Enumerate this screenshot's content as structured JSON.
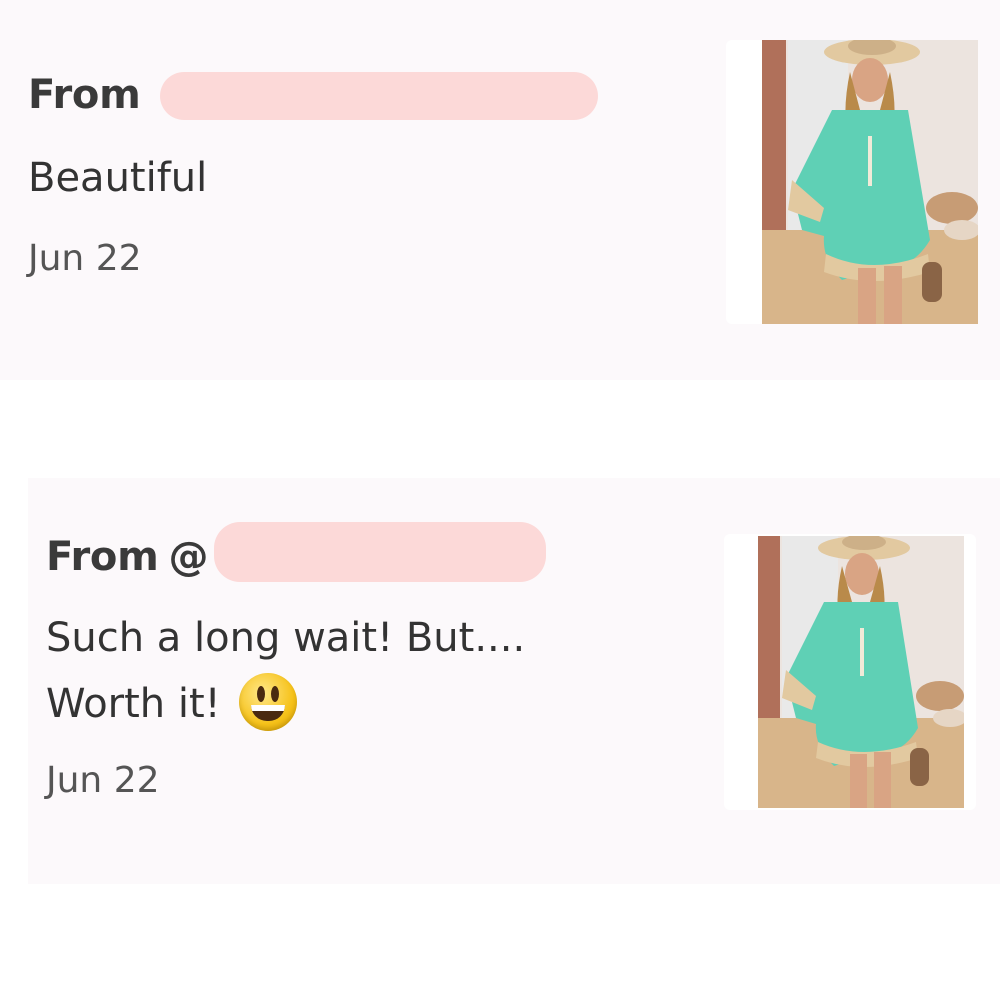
{
  "reviews": [
    {
      "from_label": "From",
      "handle": "",
      "message_line1": "Beautiful",
      "message_line2": "",
      "date": "Jun 22",
      "image": "woman-in-teal-floral-dress-photo"
    },
    {
      "from_label": "From",
      "handle": "@",
      "message_line1": "Such a long wait! But....",
      "message_line2": "Worth it!",
      "emoji": "smiley-emoji",
      "date": "Jun 22",
      "image": "woman-in-teal-floral-dress-photo"
    }
  ],
  "colors": {
    "card_bg": "#fcf9fb",
    "redaction": "#fcd9d8",
    "dress": "#5fd0b5",
    "sand": "#d8b58a"
  }
}
